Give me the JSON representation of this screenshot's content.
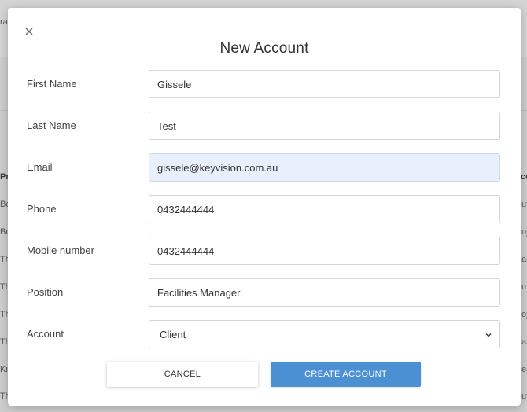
{
  "background": {
    "fragments": [
      "ra",
      "Pr",
      "Bo",
      "Bo",
      "Th",
      "Th",
      "Th",
      "Th",
      "Kir",
      "Th",
      "ce",
      "uff",
      "oje",
      "an",
      "uff",
      "oje",
      "an",
      "er",
      "uff"
    ]
  },
  "modal": {
    "title": "New Account",
    "close_icon": "close-icon",
    "fields": {
      "first_name": {
        "label": "First Name",
        "value": "Gissele"
      },
      "last_name": {
        "label": "Last Name",
        "value": "Test"
      },
      "email": {
        "label": "Email",
        "value": "gissele@keyvision.com.au"
      },
      "phone": {
        "label": "Phone",
        "value": "0432444444"
      },
      "mobile": {
        "label": "Mobile number",
        "value": "0432444444"
      },
      "position": {
        "label": "Position",
        "value": "Facilities Manager"
      },
      "account": {
        "label": "Account",
        "value": "Client"
      }
    },
    "buttons": {
      "cancel": "CANCEL",
      "create": "CREATE ACCOUNT"
    }
  },
  "colors": {
    "primary": "#4a90d2",
    "autofill": "#e8f0fe"
  }
}
